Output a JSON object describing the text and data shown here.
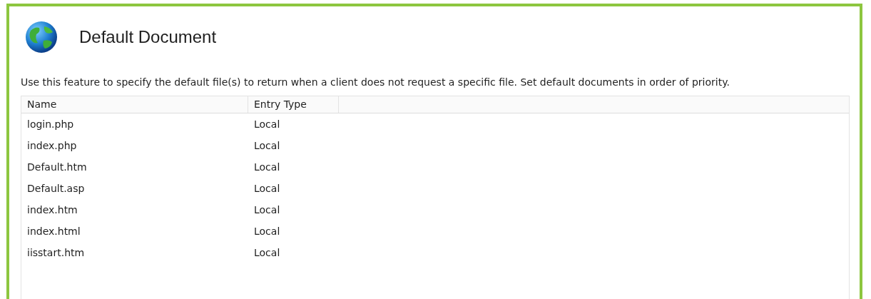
{
  "page": {
    "title": "Default Document",
    "description": "Use this feature to specify the default file(s) to return when a client does not request a specific file. Set default documents in order of priority."
  },
  "table": {
    "columns": [
      "Name",
      "Entry Type"
    ],
    "rows": [
      {
        "name": "login.php",
        "entry_type": "Local"
      },
      {
        "name": "index.php",
        "entry_type": "Local"
      },
      {
        "name": "Default.htm",
        "entry_type": "Local"
      },
      {
        "name": "Default.asp",
        "entry_type": "Local"
      },
      {
        "name": "index.htm",
        "entry_type": "Local"
      },
      {
        "name": "index.html",
        "entry_type": "Local"
      },
      {
        "name": "iisstart.htm",
        "entry_type": "Local"
      }
    ]
  }
}
